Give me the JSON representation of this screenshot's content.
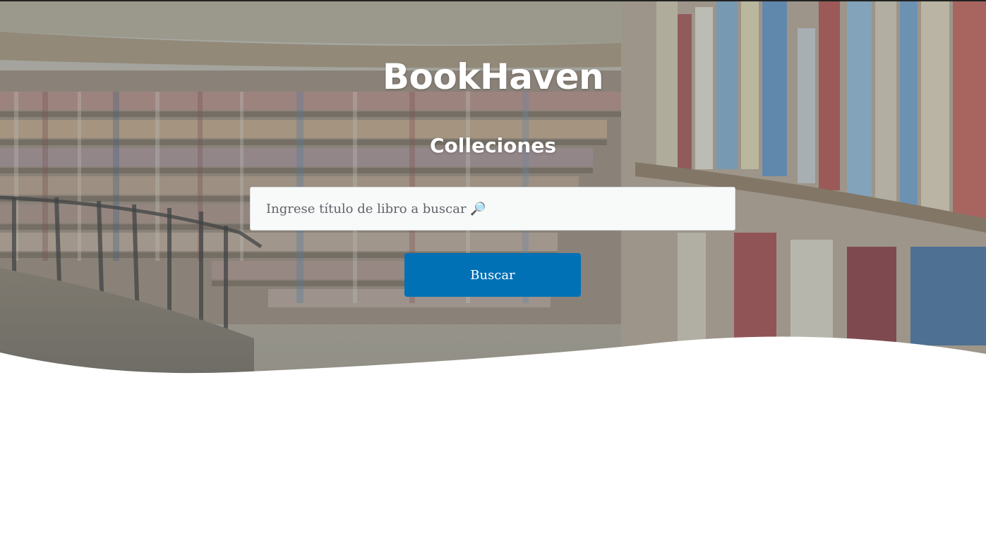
{
  "header": {
    "brand": "BookHaven",
    "subtitle": "Colleciones"
  },
  "search": {
    "placeholder": "Ingrese título de libro a buscar 🔎",
    "value": "",
    "button_label": "Buscar"
  },
  "colors": {
    "accent": "#0071b5",
    "overlay": "#6b7b88",
    "page_bg": "#ffffff"
  },
  "hero": {
    "background_icon": "library-bookshelves-photo"
  }
}
